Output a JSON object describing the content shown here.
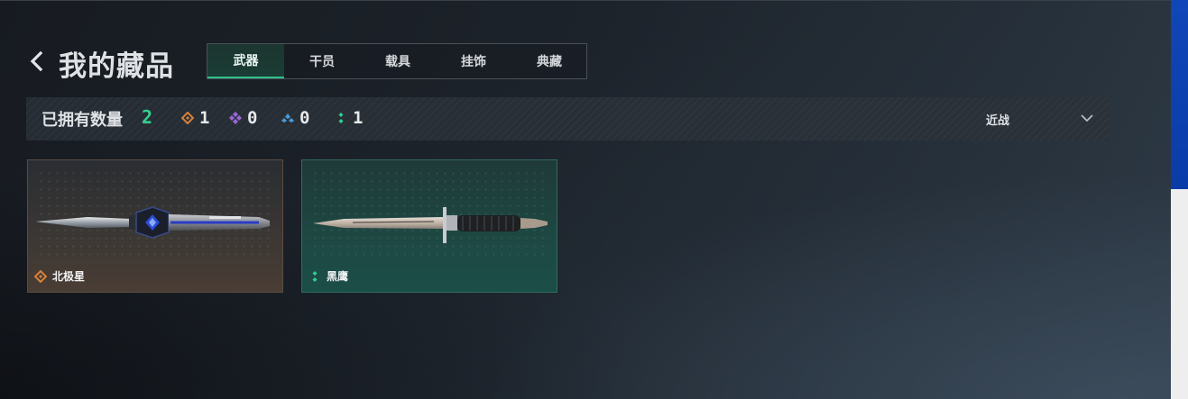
{
  "header": {
    "title": "我的藏品",
    "tabs": [
      {
        "label": "武器",
        "active": true
      },
      {
        "label": "干员",
        "active": false
      },
      {
        "label": "载具",
        "active": false
      },
      {
        "label": "挂饰",
        "active": false
      },
      {
        "label": "典藏",
        "active": false
      }
    ]
  },
  "filter": {
    "owned_label": "已拥有数量",
    "owned_count": "2",
    "rarities": [
      {
        "icon": "orange-diamond-icon",
        "color": "#d9823b",
        "count": "1"
      },
      {
        "icon": "purple-diamond-icon",
        "color": "#9a67d8",
        "count": "0"
      },
      {
        "icon": "blue-chevron-icon",
        "color": "#4b9ad8",
        "count": "0"
      },
      {
        "icon": "green-dots-icon",
        "color": "#2fd08e",
        "count": "1"
      }
    ],
    "sort": {
      "selected": "近战"
    }
  },
  "items": [
    {
      "name": "北极星",
      "rarity_icon": "orange-diamond-icon",
      "rarity_color": "#d9823b"
    },
    {
      "name": "黑鹰",
      "rarity_icon": "green-dots-icon",
      "rarity_color": "#2fd08e"
    }
  ],
  "colors": {
    "accent": "#2fd08e",
    "background": "#1a1f26"
  }
}
